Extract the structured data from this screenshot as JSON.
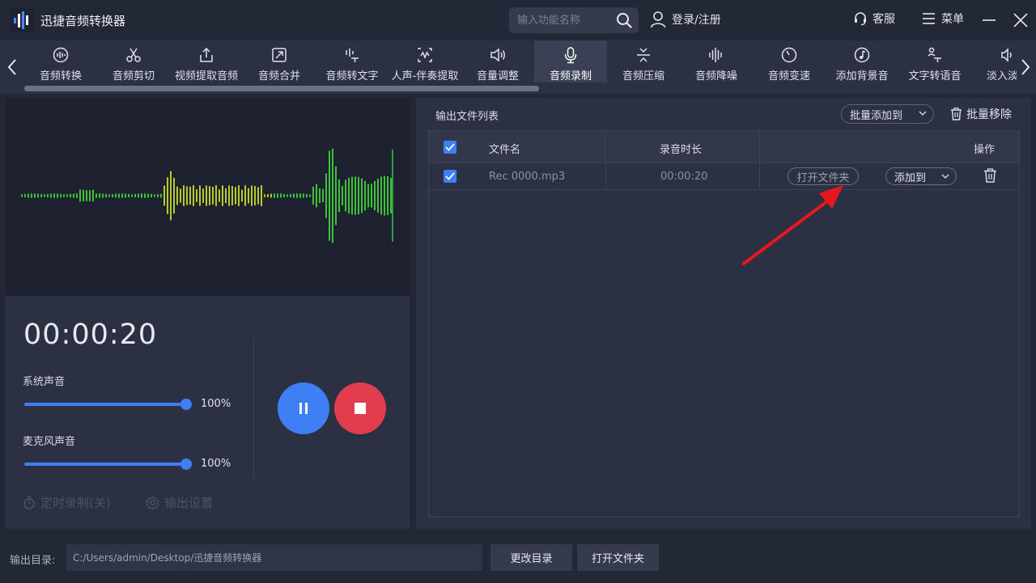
{
  "app": {
    "title": "迅捷音频转换器"
  },
  "titlebar": {
    "search_placeholder": "输入功能名称",
    "login_label": "登录/注册",
    "service_label": "客服",
    "menu_label": "菜单"
  },
  "tools": [
    {
      "label": "音频转换",
      "icon": "audio-convert-icon"
    },
    {
      "label": "音频剪切",
      "icon": "scissors-icon"
    },
    {
      "label": "视频提取音频",
      "icon": "upload-icon"
    },
    {
      "label": "音频合并",
      "icon": "merge-icon"
    },
    {
      "label": "音频转文字",
      "icon": "audio-to-text-icon"
    },
    {
      "label": "人声-伴奏提取",
      "icon": "vocal-extract-icon"
    },
    {
      "label": "音量调整",
      "icon": "volume-icon"
    },
    {
      "label": "音频录制",
      "icon": "microphone-icon",
      "active": true
    },
    {
      "label": "音频压缩",
      "icon": "compress-icon"
    },
    {
      "label": "音频降噪",
      "icon": "denoise-icon"
    },
    {
      "label": "音频变速",
      "icon": "speed-icon"
    },
    {
      "label": "添加背景音",
      "icon": "music-note-icon"
    },
    {
      "label": "文字转语音",
      "icon": "text-to-speech-icon"
    },
    {
      "label": "淡入淡出",
      "icon": "fade-icon"
    }
  ],
  "recorder": {
    "timer": "00:00:20",
    "system_label": "系统声音",
    "system_volume": 100,
    "system_volume_text": "100%",
    "mic_label": "麦克风声音",
    "mic_volume": 100,
    "mic_volume_text": "100%",
    "timer_rec_label": "定时录制(关)",
    "output_settings_label": "输出设置"
  },
  "file_list": {
    "title": "输出文件列表",
    "batch_add_label": "批量添加到",
    "batch_remove_label": "批量移除",
    "columns": {
      "name": "文件名",
      "duration": "录音时长",
      "actions": "操作"
    },
    "rows": [
      {
        "name": "Rec 0000.mp3",
        "duration": "00:00:20",
        "open_label": "打开文件夹",
        "add_label": "添加到",
        "checked": true
      }
    ]
  },
  "footer": {
    "output_label": "输出目录:",
    "output_path": "C:/Users/admin/Desktop/迅捷音频转换器",
    "change_dir_label": "更改目录",
    "open_folder_label": "打开文件夹"
  },
  "colors": {
    "accent": "#3f7ff5",
    "stop": "#e23c4f",
    "annotation_arrow": "#e8161d",
    "wave_green": "#3fc23a",
    "wave_yellow": "#b9c82a"
  }
}
